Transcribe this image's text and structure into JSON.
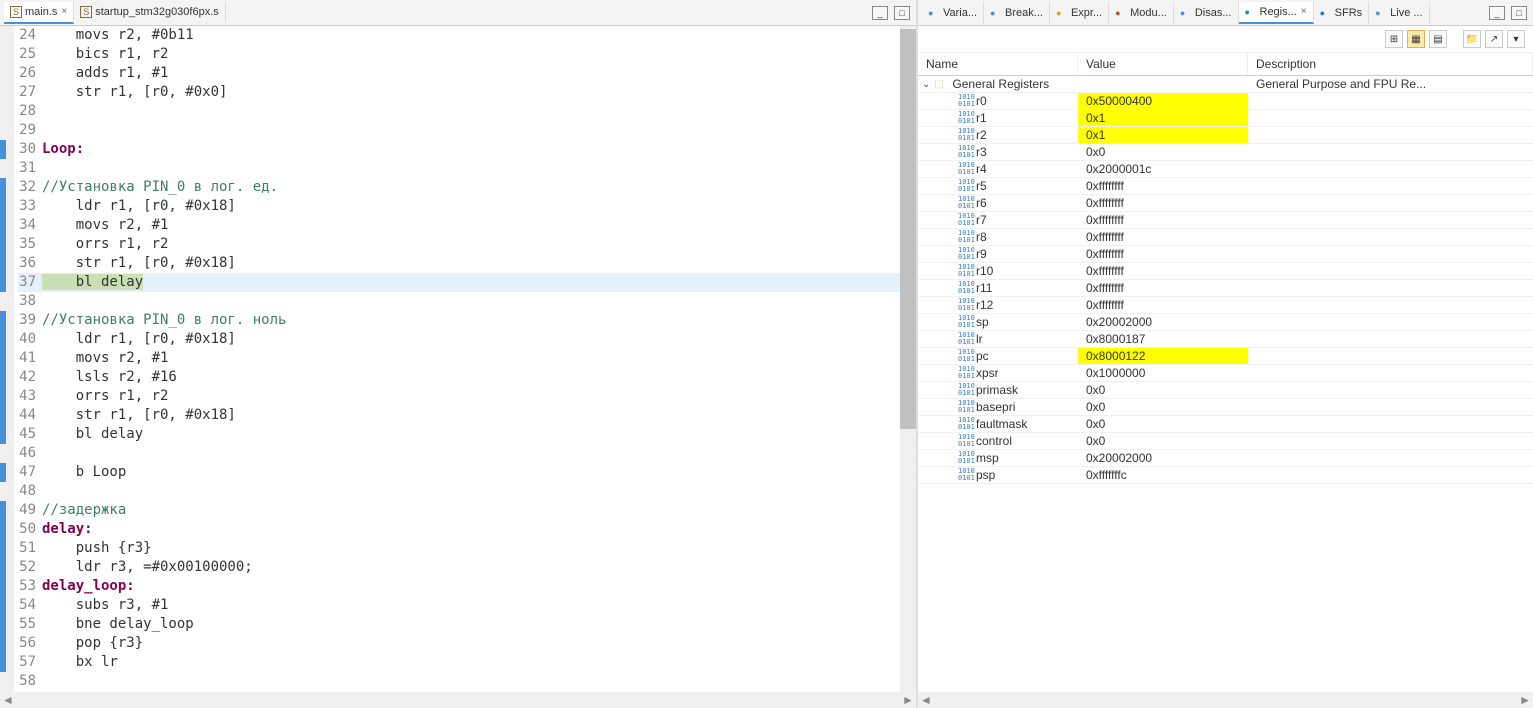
{
  "left": {
    "tabs": [
      {
        "icon": "S",
        "label": "main.s",
        "active": true
      },
      {
        "icon": "S",
        "label": "startup_stm32g030f6px.s",
        "active": false
      }
    ],
    "current_line": 37,
    "code": [
      {
        "n": 24,
        "text": "    movs r2, #0b11"
      },
      {
        "n": 25,
        "text": "    bics r1, r2"
      },
      {
        "n": 26,
        "text": "    adds r1, #1"
      },
      {
        "n": 27,
        "text": "    str r1, [r0, #0x0]"
      },
      {
        "n": 28,
        "text": ""
      },
      {
        "n": 29,
        "text": ""
      },
      {
        "n": 30,
        "text": "Loop:",
        "label": true
      },
      {
        "n": 31,
        "text": ""
      },
      {
        "n": 32,
        "text": "//Установка PIN_0 в лог. ед.",
        "comment": true
      },
      {
        "n": 33,
        "text": "    ldr r1, [r0, #0x18]"
      },
      {
        "n": 34,
        "text": "    movs r2, #1"
      },
      {
        "n": 35,
        "text": "    orrs r1, r2"
      },
      {
        "n": 36,
        "text": "    str r1, [r0, #0x18]"
      },
      {
        "n": 37,
        "text": "    bl delay",
        "current": true
      },
      {
        "n": 38,
        "text": ""
      },
      {
        "n": 39,
        "text": "//Установка PIN_0 в лог. ноль",
        "comment": true
      },
      {
        "n": 40,
        "text": "    ldr r1, [r0, #0x18]"
      },
      {
        "n": 41,
        "text": "    movs r2, #1"
      },
      {
        "n": 42,
        "text": "    lsls r2, #16"
      },
      {
        "n": 43,
        "text": "    orrs r1, r2"
      },
      {
        "n": 44,
        "text": "    str r1, [r0, #0x18]"
      },
      {
        "n": 45,
        "text": "    bl delay"
      },
      {
        "n": 46,
        "text": ""
      },
      {
        "n": 47,
        "text": "    b Loop"
      },
      {
        "n": 48,
        "text": ""
      },
      {
        "n": 49,
        "text": "//задержка",
        "comment": true
      },
      {
        "n": 50,
        "text": "delay:",
        "label": true
      },
      {
        "n": 51,
        "text": "    push {r3}"
      },
      {
        "n": 52,
        "text": "    ldr r3, =#0x00100000;"
      },
      {
        "n": 53,
        "text": "delay_loop:",
        "label": true
      },
      {
        "n": 54,
        "text": "    subs r3, #1"
      },
      {
        "n": 55,
        "text": "    bne delay_loop"
      },
      {
        "n": 56,
        "text": "    pop {r3}"
      },
      {
        "n": 57,
        "text": "    bx lr"
      },
      {
        "n": 58,
        "text": ""
      }
    ]
  },
  "right": {
    "tabs": [
      {
        "label": "Varia...",
        "icon": "(x)="
      },
      {
        "label": "Break..."
      },
      {
        "label": "Expr..."
      },
      {
        "label": "Modu..."
      },
      {
        "label": "Disas..."
      },
      {
        "label": "Regis...",
        "active": true
      },
      {
        "label": "SFRs"
      },
      {
        "label": "Live ..."
      }
    ],
    "columns": {
      "name": "Name",
      "value": "Value",
      "description": "Description"
    },
    "group": {
      "name": "General Registers",
      "description": "General Purpose and FPU Re..."
    },
    "registers": [
      {
        "name": "r0",
        "value": "0x50000400",
        "changed": true
      },
      {
        "name": "r1",
        "value": "0x1",
        "changed": true
      },
      {
        "name": "r2",
        "value": "0x1",
        "changed": true
      },
      {
        "name": "r3",
        "value": "0x0"
      },
      {
        "name": "r4",
        "value": "0x2000001c"
      },
      {
        "name": "r5",
        "value": "0xffffffff"
      },
      {
        "name": "r6",
        "value": "0xffffffff"
      },
      {
        "name": "r7",
        "value": "0xffffffff"
      },
      {
        "name": "r8",
        "value": "0xffffffff"
      },
      {
        "name": "r9",
        "value": "0xffffffff"
      },
      {
        "name": "r10",
        "value": "0xffffffff"
      },
      {
        "name": "r11",
        "value": "0xffffffff"
      },
      {
        "name": "r12",
        "value": "0xffffffff"
      },
      {
        "name": "sp",
        "value": "0x20002000"
      },
      {
        "name": "lr",
        "value": "0x8000187"
      },
      {
        "name": "pc",
        "value": "0x8000122",
        "changed": true
      },
      {
        "name": "xpsr",
        "value": "0x1000000"
      },
      {
        "name": "primask",
        "value": "0x0"
      },
      {
        "name": "basepri",
        "value": "0x0"
      },
      {
        "name": "faultmask",
        "value": "0x0"
      },
      {
        "name": "control",
        "value": "0x0"
      },
      {
        "name": "msp",
        "value": "0x20002000"
      },
      {
        "name": "psp",
        "value": "0xfffffffc"
      }
    ]
  }
}
